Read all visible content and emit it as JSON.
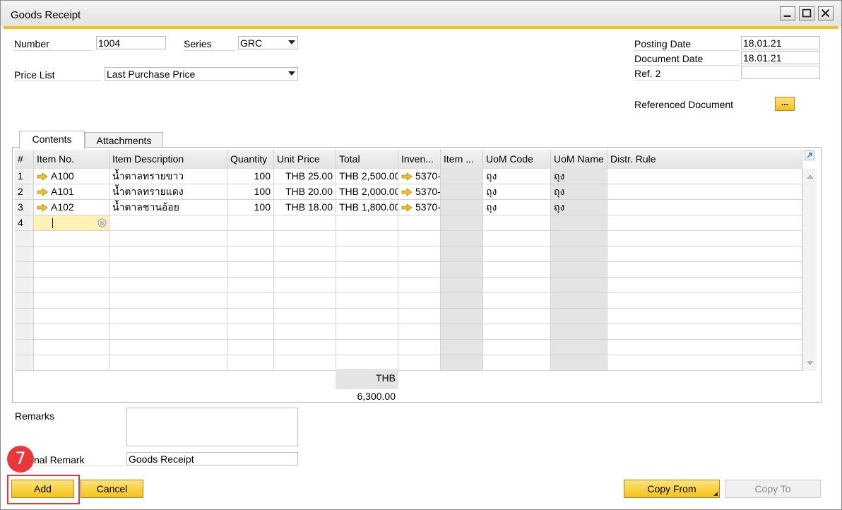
{
  "window": {
    "title": "Goods Receipt"
  },
  "header": {
    "number_label": "Number",
    "number_value": "1004",
    "series_label": "Series",
    "series_value": "GRC",
    "price_list_label": "Price List",
    "price_list_value": "Last Purchase Price",
    "posting_date_label": "Posting Date",
    "posting_date_value": "18.01.21",
    "document_date_label": "Document Date",
    "document_date_value": "18.01.21",
    "ref2_label": "Ref. 2",
    "ref2_value": "",
    "referenced_document_label": "Referenced Document",
    "referenced_document_button": "..."
  },
  "tabs": [
    {
      "label": "Contents",
      "active": true
    },
    {
      "label": "Attachments",
      "active": false
    }
  ],
  "grid": {
    "columns": [
      "#",
      "Item No.",
      "Item Description",
      "Quantity",
      "Unit Price",
      "Total",
      "Inven...",
      "Item ...",
      "UoM Code",
      "UoM Name",
      "Distr. Rule"
    ],
    "rows": [
      {
        "num": "1",
        "item_no": "A100",
        "description": "น้ำตาลทรายขาว",
        "quantity": "100",
        "unit_price": "THB 25.00",
        "total": "THB 2,500.00",
        "inventory": "5370-",
        "item_x": "",
        "uom_code": "ถุง",
        "uom_name": "ถุง",
        "distr_rule": ""
      },
      {
        "num": "2",
        "item_no": "A101",
        "description": "น้ำตาลทรายแดง",
        "quantity": "100",
        "unit_price": "THB 20.00",
        "total": "THB 2,000.00",
        "inventory": "5370-",
        "item_x": "",
        "uom_code": "ถุง",
        "uom_name": "ถุง",
        "distr_rule": ""
      },
      {
        "num": "3",
        "item_no": "A102",
        "description": "น้ำตาลชานอ้อย",
        "quantity": "100",
        "unit_price": "THB 18.00",
        "total": "THB 1,800.00",
        "inventory": "5370-",
        "item_x": "",
        "uom_code": "ถุง",
        "uom_name": "ถุง",
        "distr_rule": ""
      },
      {
        "num": "4",
        "item_no": "",
        "description": "",
        "quantity": "",
        "unit_price": "",
        "total": "",
        "inventory": "",
        "item_x": "",
        "uom_code": "",
        "uom_name": "",
        "distr_rule": ""
      }
    ],
    "grand_total": "THB 6,300.00"
  },
  "footer": {
    "remarks_label": "Remarks",
    "remarks_value": "",
    "journal_remark_label": "nal Remark",
    "journal_remark_value": "Goods Receipt"
  },
  "buttons": {
    "add": "Add",
    "cancel": "Cancel",
    "copy_from": "Copy From",
    "copy_to": "Copy To"
  },
  "annotation": {
    "step": "7"
  },
  "colors": {
    "accent": "#f6c21a",
    "highlight": "#e0393e",
    "row_arrow": "#f2c21d"
  }
}
